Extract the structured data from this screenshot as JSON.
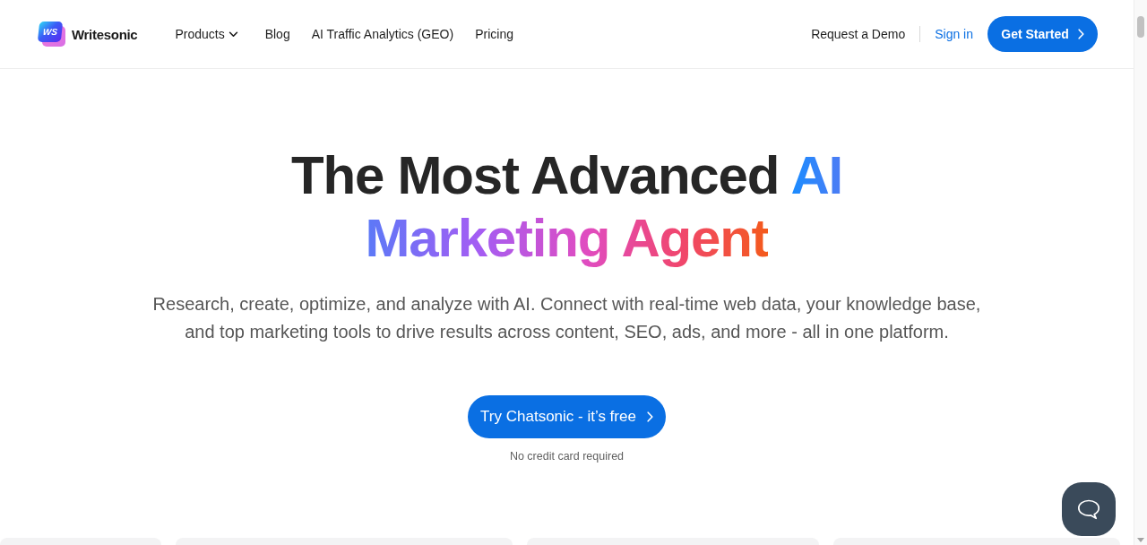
{
  "header": {
    "logo": {
      "mark": "WS",
      "name": "Writesonic"
    },
    "nav": [
      {
        "label": "Products",
        "kind": "dropdown"
      },
      {
        "label": "Blog",
        "kind": "link"
      },
      {
        "label": "AI Traffic Analytics (GEO)",
        "kind": "link"
      },
      {
        "label": "Pricing",
        "kind": "link"
      }
    ],
    "actions": [
      {
        "label": "Request a Demo",
        "kind": "link"
      },
      {
        "label": "Sign in",
        "kind": "accent_link"
      },
      {
        "label": "Get Started",
        "kind": "button"
      }
    ]
  },
  "hero": {
    "title_lines": [
      [
        {
          "text": "The Most Advanced ",
          "kind": "plain"
        },
        {
          "text": "AI",
          "kind": "accent"
        }
      ],
      [
        {
          "text": "Marketing Agent",
          "kind": "gradient"
        }
      ]
    ],
    "description": "Research, create, optimize, and analyze with AI. Connect with real-time web data, your knowledge base, and top marketing tools to drive results across content, SEO, ads, and more - all in one platform.",
    "cta": "Try Chatsonic - it’s free",
    "note": "No credit card required"
  }
}
